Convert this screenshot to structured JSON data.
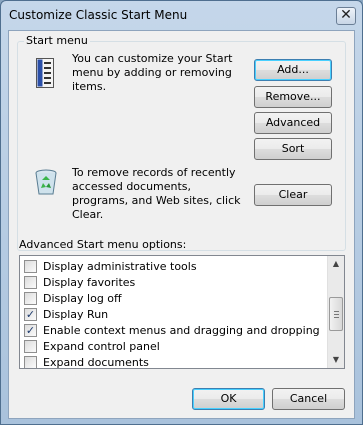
{
  "window": {
    "title": "Customize Classic Start Menu",
    "close_glyph": "✕"
  },
  "start_menu_group": {
    "legend": "Start menu",
    "description": "You can customize your Start menu by adding or removing items.",
    "clear_description": "To remove records of recently accessed documents, programs, and Web sites, click Clear.",
    "buttons": {
      "add": "Add...",
      "remove": "Remove...",
      "advanced": "Advanced",
      "sort": "Sort",
      "clear": "Clear"
    }
  },
  "advanced_options": {
    "label": "Advanced Start menu options:",
    "items": [
      {
        "label": "Display administrative tools",
        "checked": false
      },
      {
        "label": "Display favorites",
        "checked": false
      },
      {
        "label": "Display log off",
        "checked": false
      },
      {
        "label": "Display Run",
        "checked": true
      },
      {
        "label": "Enable context menus and dragging and dropping",
        "checked": true
      },
      {
        "label": "Expand control panel",
        "checked": false
      },
      {
        "label": "Expand documents",
        "checked": false
      }
    ]
  },
  "footer": {
    "ok": "OK",
    "cancel": "Cancel"
  },
  "icons": {
    "start_menu": "start-menu-icon",
    "recycle_bin": "recycle-bin-icon"
  },
  "colors": {
    "title_bar": "#c5d7ea",
    "client_bg": "#f0f0f0",
    "check_mark": "#1c3a6c"
  }
}
